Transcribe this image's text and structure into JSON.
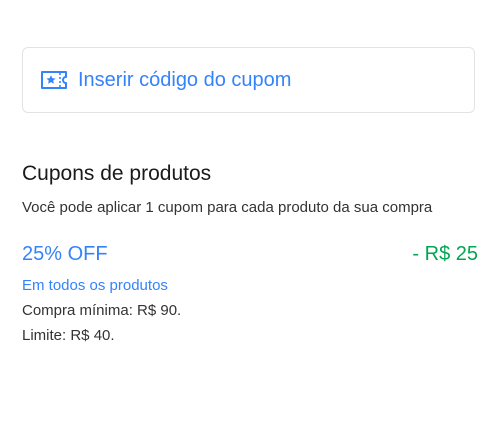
{
  "coupon_input": {
    "label": "Inserir código do cupom",
    "icon": "ticket-star-icon"
  },
  "section": {
    "title": "Cupons de produtos",
    "subtitle": "Você pode aplicar 1 cupom para cada produto da sua compra"
  },
  "coupon": {
    "name": "25% OFF",
    "discount": "- R$ 25",
    "scope": "Em todos os produtos",
    "minimum": "Compra mínima: R$ 90.",
    "limit": "Limite: R$ 40."
  },
  "colors": {
    "accent": "#3483fa",
    "success": "#00a650",
    "text": "#333333"
  }
}
